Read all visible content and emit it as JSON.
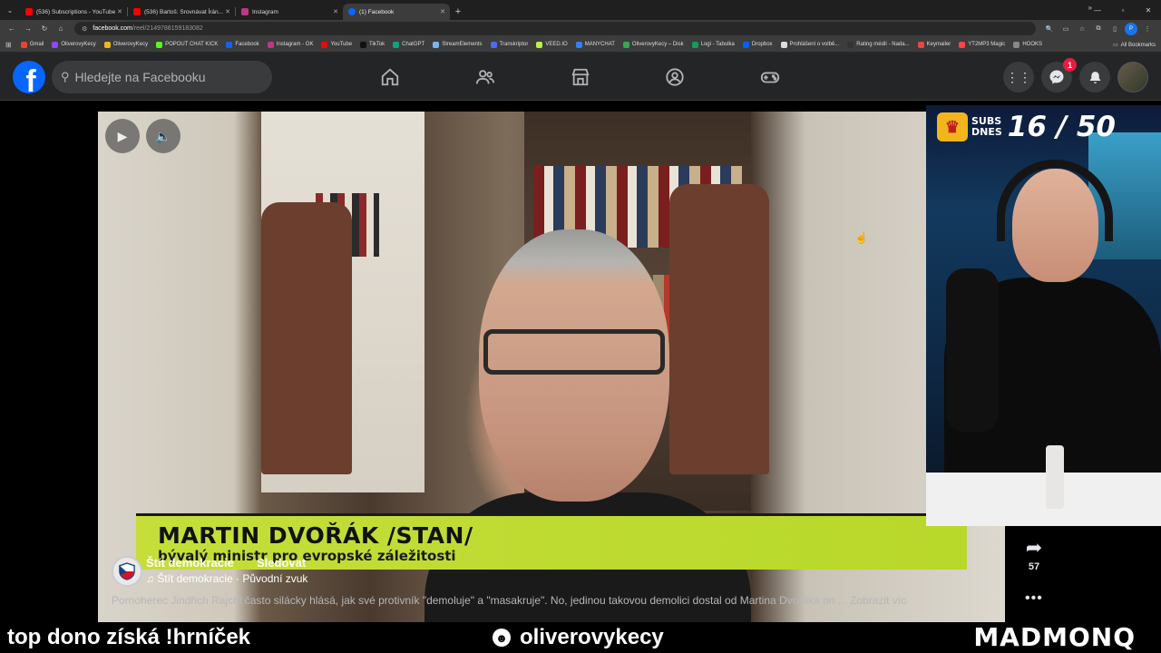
{
  "browser": {
    "tabs": [
      {
        "title": "(536) Subscriptions - YouTube",
        "color": "#ff0000"
      },
      {
        "title": "(536) Bartoš: Srovnávat Írán...",
        "color": "#ff0000"
      },
      {
        "title": "Instagram",
        "color": "#c13584"
      },
      {
        "title": "(1) Facebook",
        "color": "#0866ff",
        "active": true
      }
    ],
    "url_host": "facebook.com",
    "url_path": "/reel/2149788159183082",
    "bookmarks": [
      {
        "label": "Gmail",
        "color": "#ea4335"
      },
      {
        "label": "OliverovyKecy",
        "color": "#9146ff"
      },
      {
        "label": "OliverovyKecy",
        "color": "#f2b51b"
      },
      {
        "label": "POPOUT CHAT KICK",
        "color": "#53fc18"
      },
      {
        "label": "Facebook",
        "color": "#0866ff"
      },
      {
        "label": "Instagram - OK",
        "color": "#c13584"
      },
      {
        "label": "YouTube",
        "color": "#ff0000"
      },
      {
        "label": "TikTok",
        "color": "#111111"
      },
      {
        "label": "ChatGPT",
        "color": "#10a37f"
      },
      {
        "label": "StreamElements",
        "color": "#7ab4f5"
      },
      {
        "label": "Transkriptor",
        "color": "#4a6cf7"
      },
      {
        "label": "VEED.IO",
        "color": "#b9f04a"
      },
      {
        "label": "MANYCHAT",
        "color": "#2e80ff"
      },
      {
        "label": "OliverovyKecy – Disk",
        "color": "#34a853"
      },
      {
        "label": "Logi - Tabulka",
        "color": "#0f9d58"
      },
      {
        "label": "Dropbox",
        "color": "#0061ff"
      },
      {
        "label": "Prohlášení o volbě...",
        "color": "#dddddd"
      },
      {
        "label": "Rating médií - Nada...",
        "color": "#333333"
      },
      {
        "label": "Keymailer",
        "color": "#e44"
      },
      {
        "label": "YT2MP3 Magic",
        "color": "#ff4444"
      },
      {
        "label": "HOOKS",
        "color": "#888888"
      }
    ],
    "all_bookmarks": "All Bookmarks",
    "profile_initial": "P"
  },
  "facebook": {
    "logo": "f",
    "search_placeholder": "Hledejte na Facebooku",
    "messenger_badge": "1"
  },
  "reel": {
    "lower_third_name": "MARTIN DVOŘÁK /STAN/",
    "lower_third_sub": "bývalý ministr pro evropské záležitosti",
    "page_name": "Štít demokracie",
    "follow_label": "Sledovat",
    "audio": "Štít demokracie · Původní zvuk",
    "caption": "Pornoherec Jindřich Rajchl často silácky hlásá, jak své protivník \"demoluje\" a \"masakruje\". No, jedinou takovou demolici dostal od Martina Dvořáka on ... Zobrazit víc",
    "share_count": "57"
  },
  "overlay": {
    "subs_label_1": "SUBS",
    "subs_label_2": "DNES",
    "subs_count": "16 / 50",
    "bottom_left": "top dono získá !hrníček",
    "bottom_center": "oliverovykecy",
    "bottom_right": "MADMONQ"
  }
}
